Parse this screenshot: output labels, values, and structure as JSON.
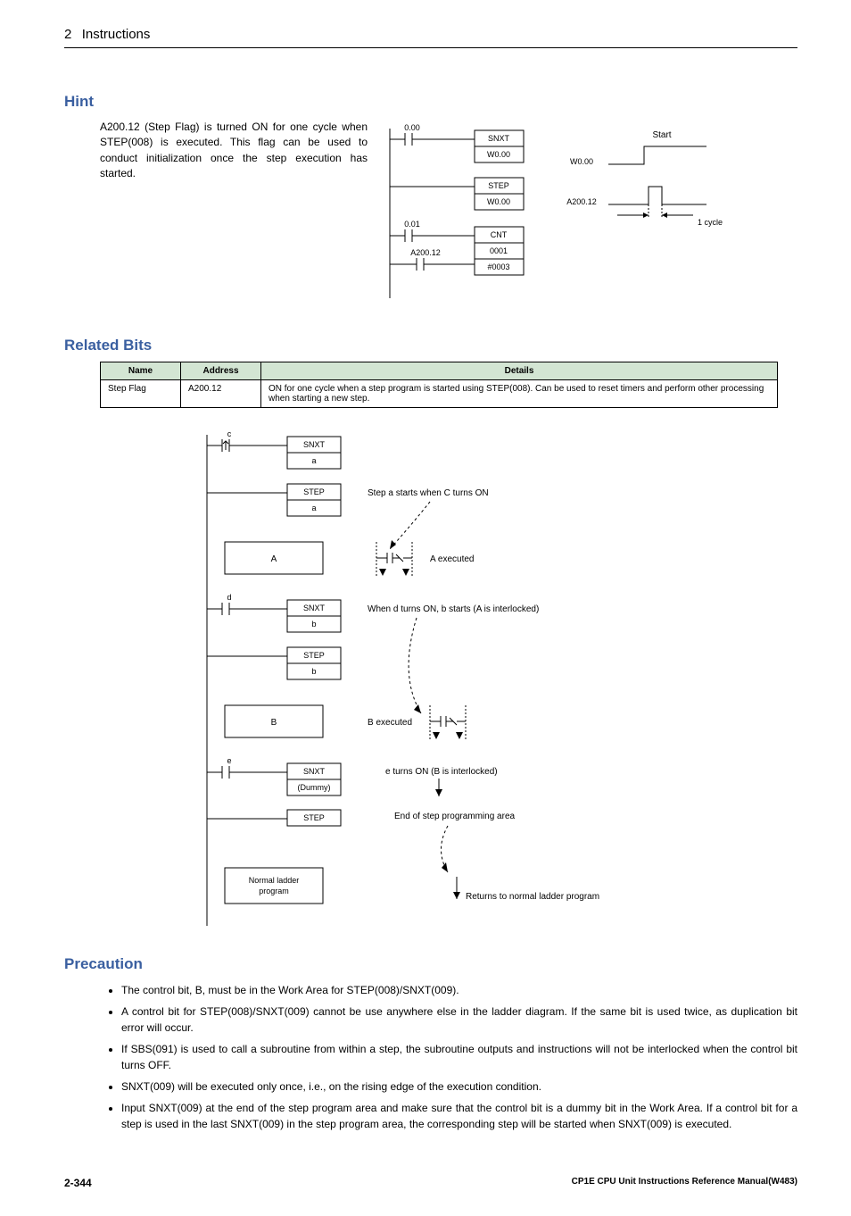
{
  "header": {
    "section_num": "2",
    "section_title": "Instructions"
  },
  "hint": {
    "title": "Hint",
    "text": "A200.12 (Step Flag) is turned ON for one cycle when STEP(008) is executed. This flag can be used to conduct initialization once the step execution has started.",
    "ladder": {
      "contact1": "0.00",
      "instr1a": "SNXT",
      "instr1b": "W0.00",
      "instr2a": "STEP",
      "instr2b": "W0.00",
      "contact2": "0.01",
      "contact3": "A200.12",
      "instr3a": "CNT",
      "instr3b": "0001",
      "instr3c": "#0003"
    },
    "timing": {
      "start_label": "Start",
      "sig1": "W0.00",
      "sig2": "A200.12",
      "cycle_label": "1 cycle"
    }
  },
  "related": {
    "title": "Related Bits",
    "headers": {
      "name": "Name",
      "address": "Address",
      "details": "Details"
    },
    "row": {
      "name": "Step Flag",
      "address": "A200.12",
      "details": "ON for one cycle when a step program is started using STEP(008). Can be used to reset timers and perform other processing when starting a new step."
    }
  },
  "big_ladder": {
    "c": "c",
    "snxt": "SNXT",
    "a": "a",
    "step": "STEP",
    "note1": "Step a starts when C turns ON",
    "A_block": "A",
    "a_exec": "A executed",
    "d": "d",
    "b": "b",
    "note2": "When d turns ON, b starts (A is interlocked)",
    "B_block": "B",
    "b_exec": "B executed",
    "e": "e",
    "dummy": "(Dummy)",
    "note3": "e turns ON (B is interlocked)",
    "note4": "End of step programming area",
    "normal": "Normal ladder program",
    "note5": "Returns to normal ladder program"
  },
  "precaution": {
    "title": "Precaution",
    "items": [
      "The control bit, B, must be in the Work Area for STEP(008)/SNXT(009).",
      "A control bit for STEP(008)/SNXT(009) cannot be use anywhere else in the ladder diagram. If the same bit is used twice, as duplication bit error will occur.",
      "If SBS(091) is used to call a subroutine from within a step, the subroutine outputs and instructions will not be interlocked when the control bit turns OFF.",
      "SNXT(009) will be executed only once, i.e., on the rising edge of the execution condition.",
      "Input SNXT(009) at the end of the step program area and make sure that the control bit is a dummy bit in the Work Area. If a control bit for a step is used in the last SNXT(009) in the step program area, the corresponding step will be started when SNXT(009) is executed."
    ]
  },
  "footer": {
    "page": "2-344",
    "manual": "CP1E CPU Unit Instructions Reference Manual(W483)"
  }
}
